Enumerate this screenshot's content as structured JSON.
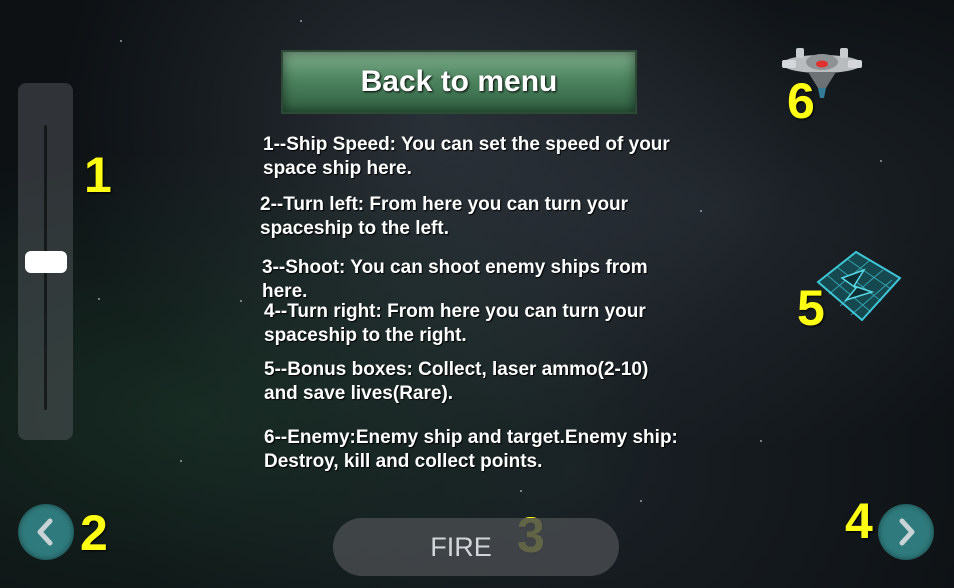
{
  "back_button": {
    "label": "Back to menu"
  },
  "instructions": [
    {
      "line1": "1--Ship Speed: You can set the speed of your",
      "line2": "space ship here."
    },
    {
      "line1": "2--Turn left: From here you can turn your",
      "line2": "spaceship to the left."
    },
    {
      "line1": "3--Shoot: You can shoot enemy ships from",
      "line2": "here."
    },
    {
      "line1": "4--Turn right: From here you can turn your",
      "line2": "spaceship to the right."
    },
    {
      "line1": "5--Bonus boxes: Collect, laser ammo(2-10)",
      "line2": "and save lives(Rare)."
    },
    {
      "line1": "6--Enemy:Enemy ship and target.Enemy ship:",
      "line2": "Destroy, kill and collect points."
    }
  ],
  "markers": {
    "m1": "1",
    "m2": "2",
    "m3": "3",
    "m4": "4",
    "m5": "5",
    "m6": "6"
  },
  "controls": {
    "fire_label": "FIRE",
    "speed_level": 0.52,
    "left_icon": "chevron-left-icon",
    "right_icon": "chevron-right-icon"
  },
  "colors": {
    "marker_yellow": "#ffff14",
    "nav_teal": "#2f7a7c",
    "menu_green": "#4e8560"
  }
}
